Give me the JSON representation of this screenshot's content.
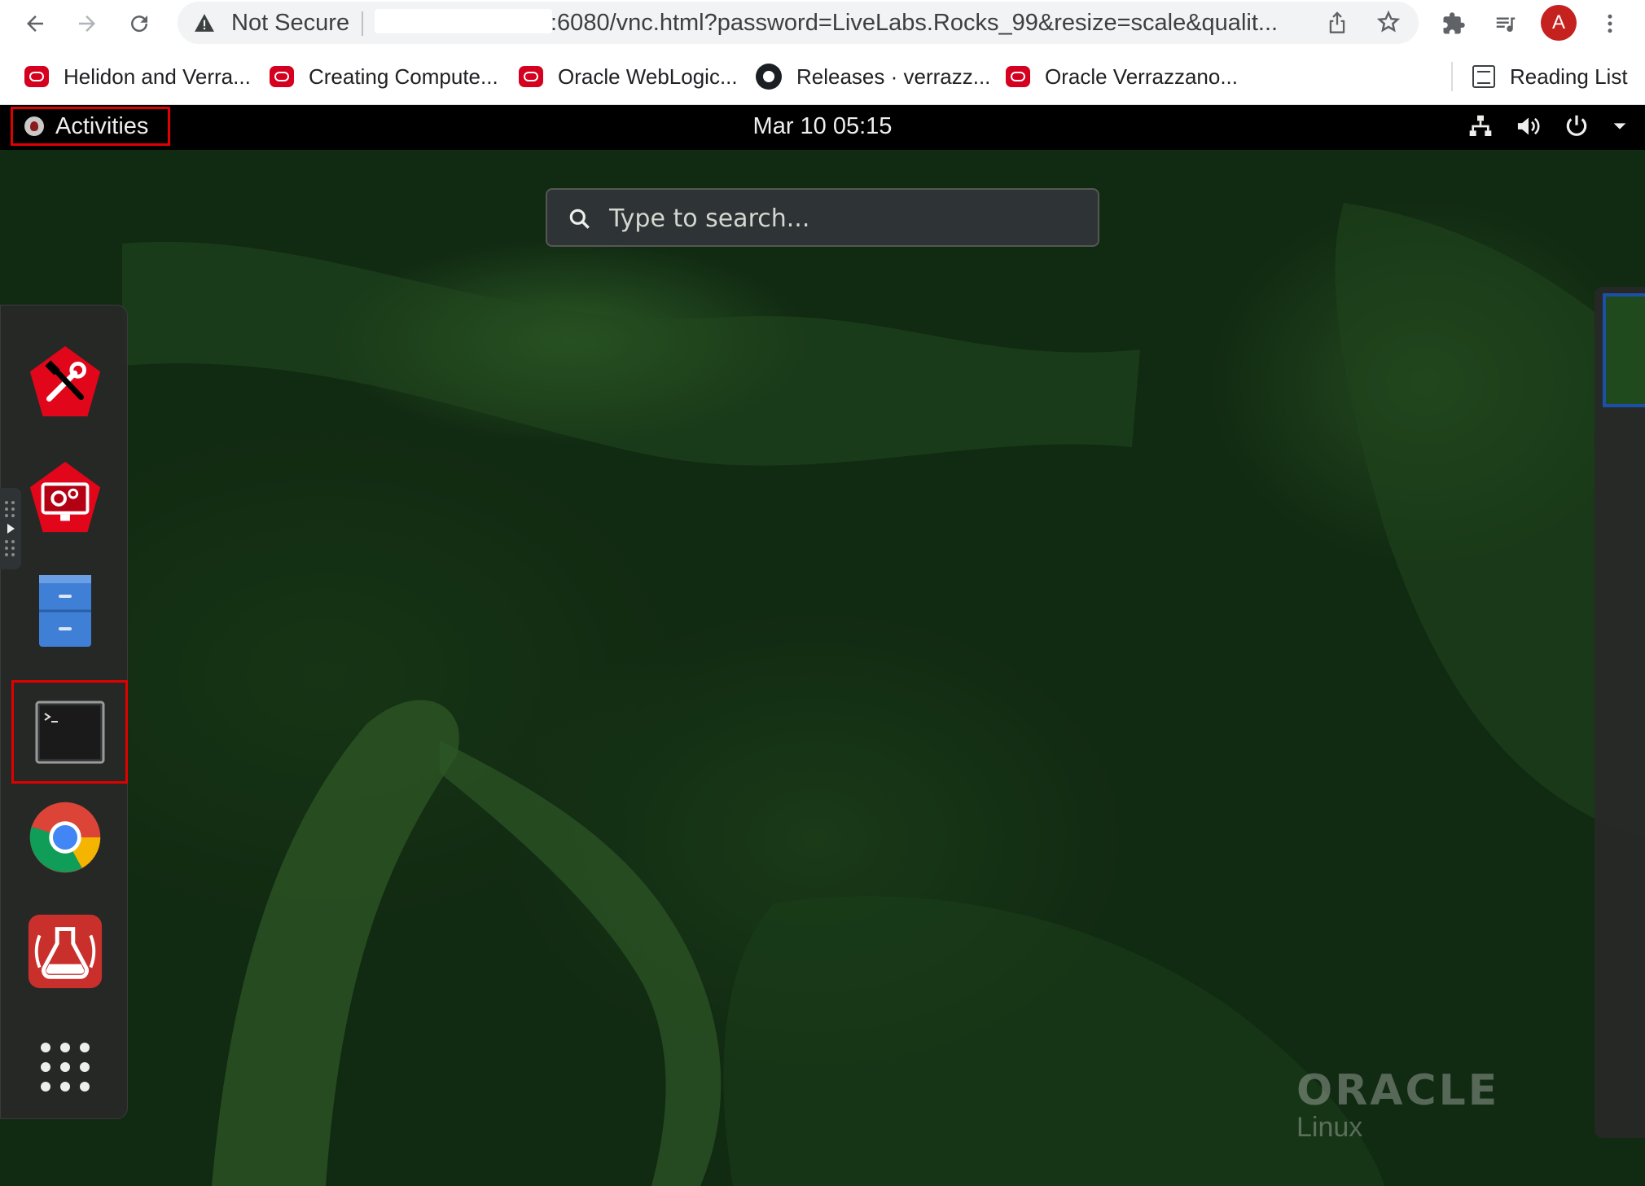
{
  "browser": {
    "security_label": "Not Secure",
    "url_visible": ":6080/vnc.html?password=LiveLabs.Rocks_99&resize=scale&qualit...",
    "avatar_letter": "A",
    "bookmarks": [
      {
        "label": "Helidon and Verra..."
      },
      {
        "label": "Creating Compute..."
      },
      {
        "label": "Oracle WebLogic..."
      },
      {
        "label": "Releases · verrazz..."
      },
      {
        "label": "Oracle Verrazzano..."
      }
    ],
    "reading_list_label": "Reading List"
  },
  "desktop": {
    "activities_label": "Activities",
    "clock": "Mar 10  05:15",
    "search_placeholder": "Type to search...",
    "dash_items": [
      "tools-app",
      "system-settings-app",
      "files-app",
      "terminal-app",
      "chrome-app",
      "lab-app",
      "show-applications"
    ],
    "brand_word": "ORACLE",
    "brand_sub": "Linux"
  },
  "colors": {
    "highlight": "#e00000",
    "topbar": "#000000",
    "wallpaper": "#112a12",
    "oracle_red": "#d5001f"
  }
}
